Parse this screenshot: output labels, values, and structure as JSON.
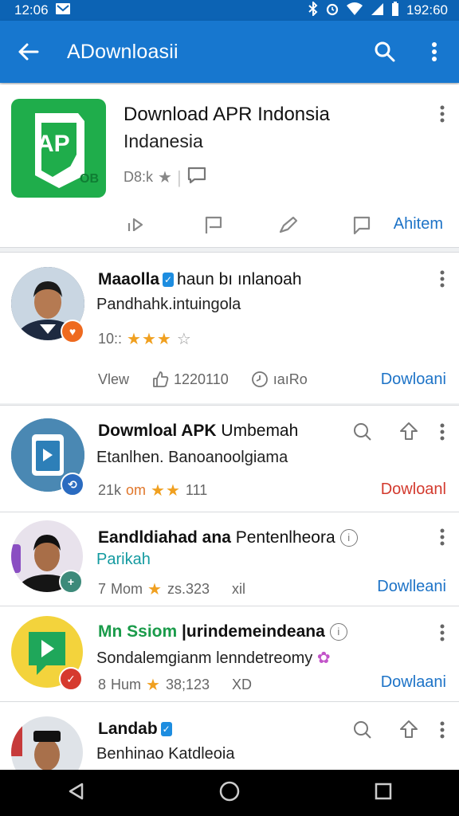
{
  "status_bar": {
    "time": "12:06",
    "battery": "192:60"
  },
  "app_bar": {
    "title": "ADownloasii"
  },
  "featured": {
    "icon_text": "AP",
    "icon_badge": "OB",
    "title_line1": "Download APR Indonsia",
    "title_line2": "Indanesia",
    "rating_text": "D8:k",
    "action_label": "Ahitem"
  },
  "items": [
    {
      "title_bold": "Maaolla",
      "title_rest": "haun bı ınlanoah",
      "subtitle": "Pandhahk.intuingola",
      "rating_prefix": "10::",
      "stars": "★★★",
      "stars_empty": "☆",
      "meta_left": "Vlew",
      "meta_mid": "1220110",
      "meta_right": "ıaıRo",
      "download": "Dowloani"
    },
    {
      "title_bold": "Dowmloal APK",
      "title_rest": "Umbemah",
      "subtitle": "Etanlhen. Banoanoolgiama",
      "rating_prefix": "21k",
      "rating_suffix_orange": "om",
      "stars": "★★",
      "count": "111",
      "download": "Dowloanl"
    },
    {
      "title_bold": "Eandldiahad ana",
      "title_rest": "Pentenlheora",
      "subtitle": "Parikah",
      "rating_prefix": "7",
      "rating_word": "Mom",
      "stars": "★",
      "count": "zs.323",
      "extra": "xil",
      "download": "Dowlleani"
    },
    {
      "title_green": "Mn Ssiom",
      "title_bold": "|urindemeindeana",
      "subtitle": "Sondalemgianm lenndetreomy",
      "rating_prefix": "8",
      "rating_word": "Hum",
      "stars": "★",
      "count": "38;123",
      "extra": "XD",
      "download": "Dowlaani"
    },
    {
      "title_bold": "Landab",
      "subtitle": "Benhinao Katdleoia"
    }
  ],
  "colors": {
    "app_bar": "#1777cf",
    "status_bar": "#0c63b4",
    "link_blue": "#1d73c7",
    "download_red": "#d33a2e",
    "star": "#f0a020",
    "featured_icon_bg": "#1fad4b"
  }
}
